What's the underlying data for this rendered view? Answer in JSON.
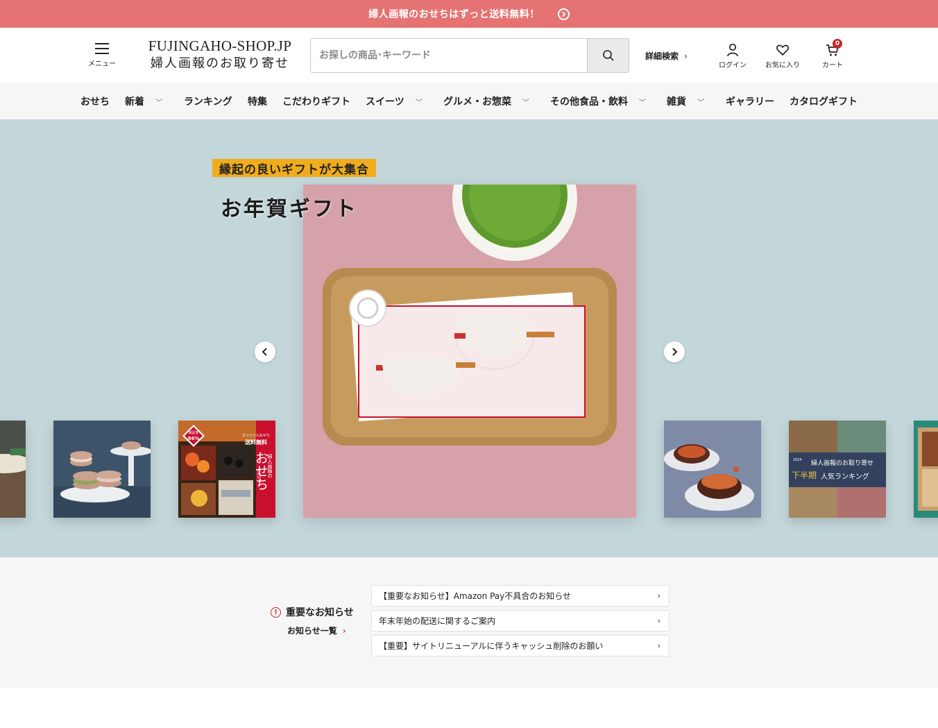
{
  "announcement": {
    "text": "婦人画報のおせちはずっと送料無料！",
    "icon": "arrow-circle-right-icon"
  },
  "header": {
    "menu_label": "メニュー",
    "logo_en": "FUJINGAHO-SHOP.JP",
    "logo_jp": "婦人画報のお取り寄せ",
    "search_placeholder": "お探しの商品･キーワード",
    "search_value": "",
    "advanced_search_label": "詳細検索",
    "login_label": "ログイン",
    "favorites_label": "お気に入り",
    "cart_label": "カート",
    "cart_count": "0",
    "accent_color": "#c62828"
  },
  "nav": {
    "items": [
      {
        "label": "おせち",
        "dropdown": false
      },
      {
        "label": "新着",
        "dropdown": true
      },
      {
        "label": "ランキング",
        "dropdown": false
      },
      {
        "label": "特集",
        "dropdown": false
      },
      {
        "label": "こだわりギフト",
        "dropdown": false
      },
      {
        "label": "スイーツ",
        "dropdown": true
      },
      {
        "label": "グルメ・お惣菜",
        "dropdown": true
      },
      {
        "label": "その他食品・飲料",
        "dropdown": true
      },
      {
        "label": "雑貨",
        "dropdown": true
      },
      {
        "label": "ギャラリー",
        "dropdown": false
      },
      {
        "label": "カタログギフト",
        "dropdown": false
      }
    ]
  },
  "hero": {
    "tagline": "縁起の良いギフトが大集合",
    "title": "お年賀ギフト",
    "background_color": "#c3d6d9",
    "tagline_color": "#f0ac1b",
    "thumbnails": {
      "osechi_badge_pct": "96%",
      "osechi_badge_top": "満足度",
      "osechi_ribbon": "送料無料",
      "osechi_ribbon_top": "オリジナルおせち",
      "osechi_title": "おせち",
      "osechi_subtitle": "婦人画報の",
      "osechi_year": "2025",
      "ranking_year": "2024",
      "ranking_line1": "婦人画報のお取り寄せ",
      "ranking_line2a": "下半期",
      "ranking_line2b": "人気ランキング"
    }
  },
  "notice": {
    "title": "重要なお知らせ",
    "all_link": "お知らせ一覧",
    "items": [
      "【重要なお知らせ】Amazon Pay不具合のお知らせ",
      "年末年始の配送に関するご案内",
      "【重要】サイトリニューアルに伴うキャッシュ削除のお願い"
    ]
  }
}
